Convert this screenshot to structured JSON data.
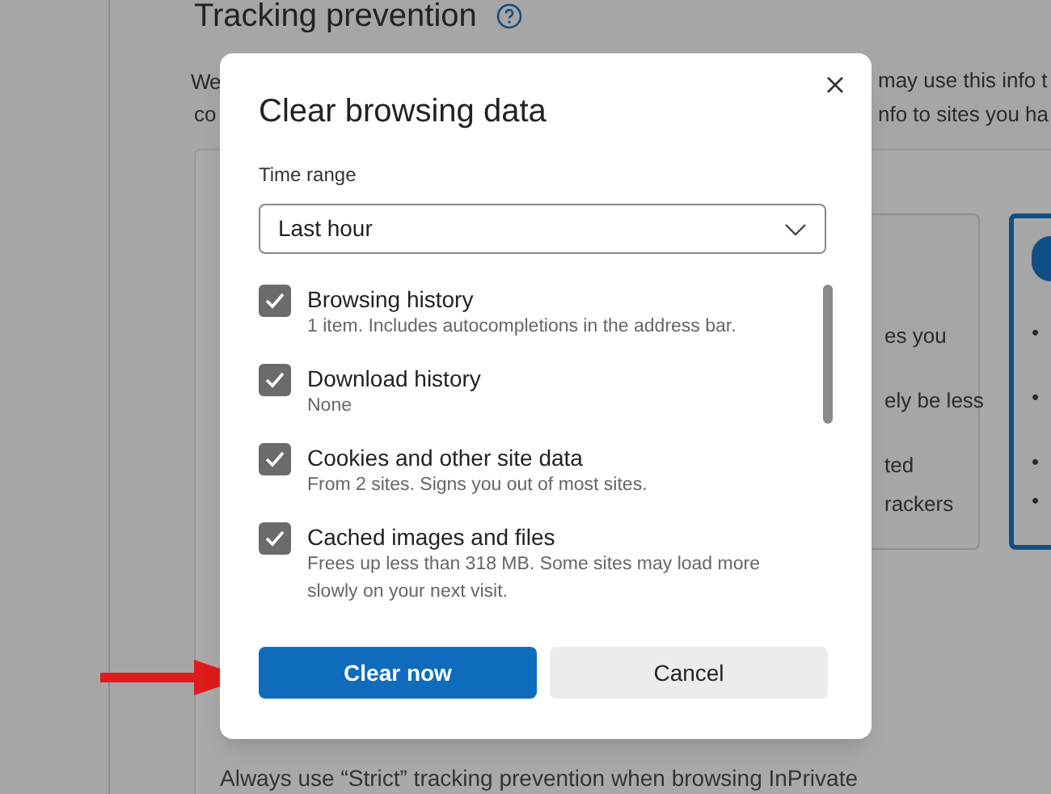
{
  "background": {
    "heading": "Tracking prevention",
    "fragments": [
      "We",
      "co",
      "may use this info t",
      "nfo to sites you ha",
      "es you",
      "ely be less",
      "ted",
      "rackers",
      "•",
      "•",
      "•",
      "•"
    ],
    "footer": "Always use “Strict” tracking prevention when browsing InPrivate"
  },
  "dialog": {
    "title": "Clear browsing data",
    "time_range": {
      "label": "Time range",
      "value": "Last hour"
    },
    "options": [
      {
        "label": "Browsing history",
        "description": "1 item. Includes autocompletions in the address bar.",
        "checked": true
      },
      {
        "label": "Download history",
        "description": "None",
        "checked": true
      },
      {
        "label": "Cookies and other site data",
        "description": "From 2 sites. Signs you out of most sites.",
        "checked": true
      },
      {
        "label": "Cached images and files",
        "description": "Frees up less than 318 MB. Some sites may load more slowly on your next visit.",
        "checked": true
      }
    ],
    "buttons": [
      {
        "label": "Clear now",
        "kind": "primary"
      },
      {
        "label": "Cancel",
        "kind": "secondary"
      }
    ]
  }
}
